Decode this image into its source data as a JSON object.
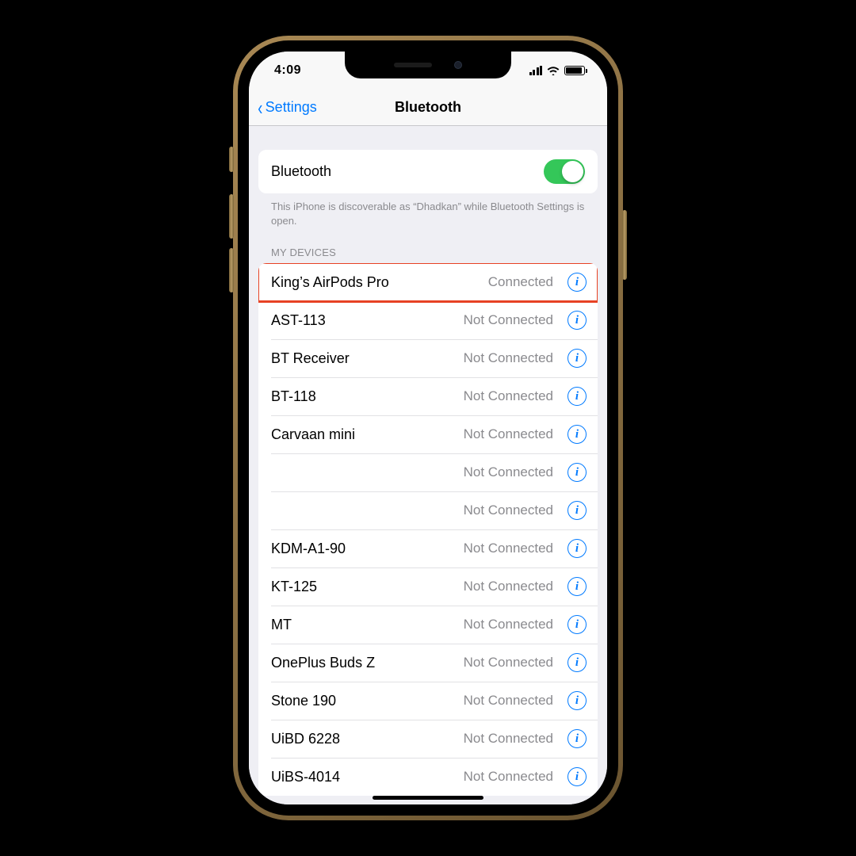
{
  "status_bar": {
    "time": "4:09"
  },
  "nav": {
    "back_label": "Settings",
    "title": "Bluetooth"
  },
  "toggle": {
    "label": "Bluetooth",
    "on": true
  },
  "footnote": "This iPhone is discoverable as “Dhadkan” while Bluetooth Settings is open.",
  "section_header": "MY DEVICES",
  "devices": [
    {
      "name": "King’s AirPods Pro",
      "status": "Connected"
    },
    {
      "name": "AST-113",
      "status": "Not Connected"
    },
    {
      "name": "BT Receiver",
      "status": "Not Connected"
    },
    {
      "name": "BT-118",
      "status": "Not Connected"
    },
    {
      "name": "Carvaan mini",
      "status": "Not Connected"
    },
    {
      "name": "",
      "status": "Not Connected"
    },
    {
      "name": "",
      "status": "Not Connected"
    },
    {
      "name": "KDM-A1-90",
      "status": "Not Connected"
    },
    {
      "name": "KT-125",
      "status": "Not Connected"
    },
    {
      "name": "MT",
      "status": "Not Connected"
    },
    {
      "name": "OnePlus Buds Z",
      "status": "Not Connected"
    },
    {
      "name": "Stone 190",
      "status": "Not Connected"
    },
    {
      "name": "UiBD 6228",
      "status": "Not Connected"
    },
    {
      "name": "UiBS-4014",
      "status": "Not Connected"
    }
  ],
  "highlighted_index": 0
}
